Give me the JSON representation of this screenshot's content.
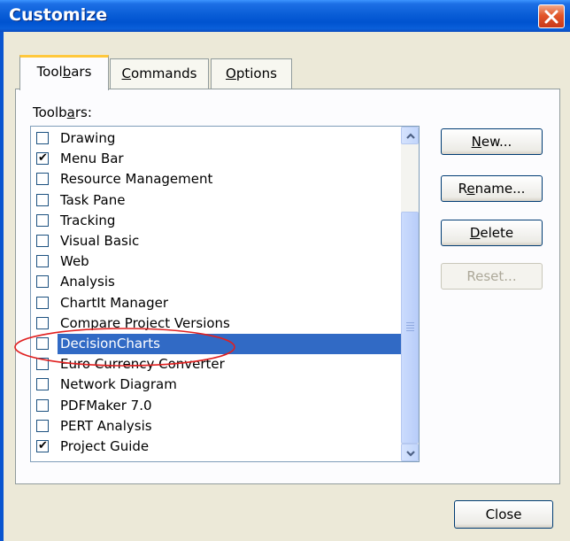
{
  "window": {
    "title": "Customize"
  },
  "tabs": [
    {
      "pre": "Tool",
      "key": "b",
      "post": "ars",
      "active": true
    },
    {
      "pre": "",
      "key": "C",
      "post": "ommands",
      "active": false
    },
    {
      "pre": "",
      "key": "O",
      "post": "ptions",
      "active": false
    }
  ],
  "toolbars_label": {
    "pre": "Toolbars:",
    "key": "a"
  },
  "toolbars": [
    {
      "label": "Drawing",
      "checked": false
    },
    {
      "label": "Menu Bar",
      "checked": true
    },
    {
      "label": "Resource Management",
      "checked": false
    },
    {
      "label": "Task Pane",
      "checked": false
    },
    {
      "label": "Tracking",
      "checked": false
    },
    {
      "label": "Visual Basic",
      "checked": false
    },
    {
      "label": "Web",
      "checked": false
    },
    {
      "label": "Analysis",
      "checked": false
    },
    {
      "label": "ChartIt Manager",
      "checked": false
    },
    {
      "label": "Compare Project Versions",
      "checked": false
    },
    {
      "label": "DecisionCharts",
      "checked": false,
      "selected": true
    },
    {
      "label": "Euro Currency Converter",
      "checked": false
    },
    {
      "label": "Network Diagram",
      "checked": false
    },
    {
      "label": "PDFMaker 7.0",
      "checked": false
    },
    {
      "label": "PERT Analysis",
      "checked": false
    },
    {
      "label": "Project Guide",
      "checked": true
    }
  ],
  "buttons": {
    "new": {
      "pre": "",
      "key": "N",
      "post": "ew..."
    },
    "rename": {
      "pre": "R",
      "key": "e",
      "post": "name..."
    },
    "delete": {
      "pre": "",
      "key": "D",
      "post": "elete"
    },
    "reset": "Reset...",
    "close": "Close"
  },
  "highlight_color": "#316ac5",
  "annotation_color": "#e02020"
}
